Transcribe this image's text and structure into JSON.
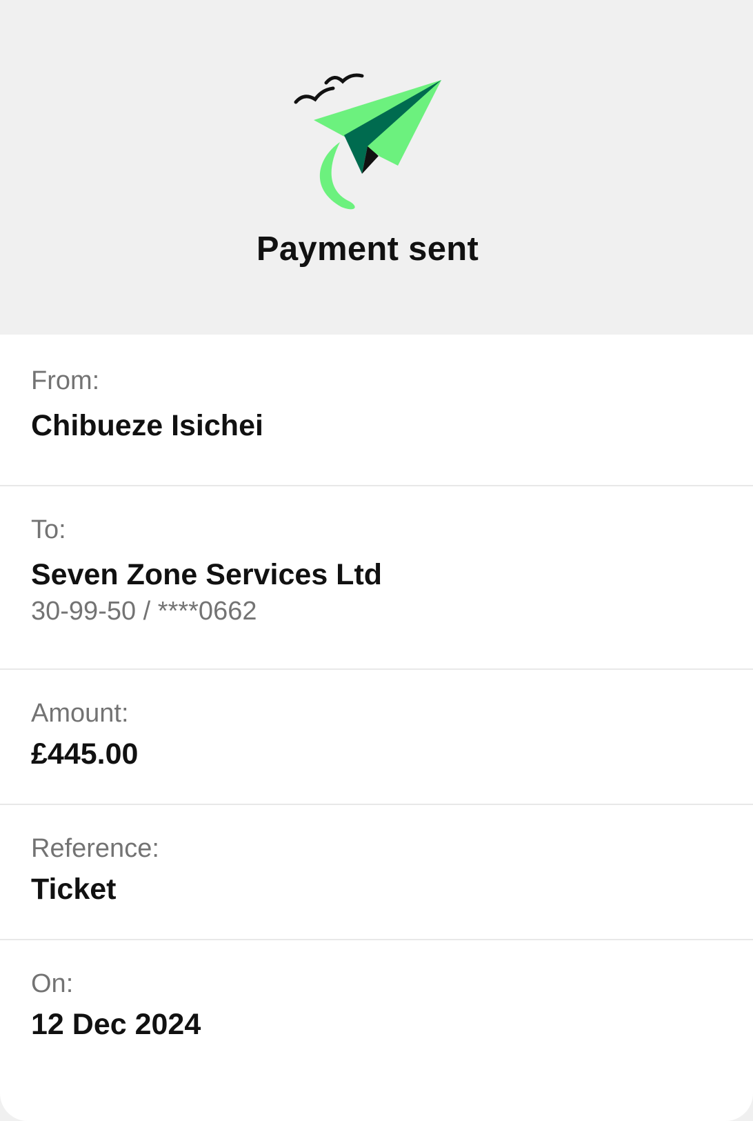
{
  "header": {
    "illustration_icon": "paper-plane-with-birds-icon",
    "title": "Payment sent"
  },
  "details": {
    "from": {
      "label": "From:",
      "value": "Chibueze Isichei"
    },
    "to": {
      "label": "To:",
      "value": "Seven Zone Services Ltd",
      "account": "30-99-50 / ****0662"
    },
    "amount": {
      "label": "Amount:",
      "value": "£445.00"
    },
    "reference": {
      "label": "Reference:",
      "value": "Ticket"
    },
    "on": {
      "label": "On:",
      "value": "12 Dec 2024"
    }
  },
  "colors": {
    "plane_light_green": "#6cf17e",
    "plane_dark_green": "#006b4f",
    "header_background": "#f0f0f0",
    "card_background": "#ffffff",
    "label_gray": "#737373",
    "text_dark": "#111111"
  }
}
